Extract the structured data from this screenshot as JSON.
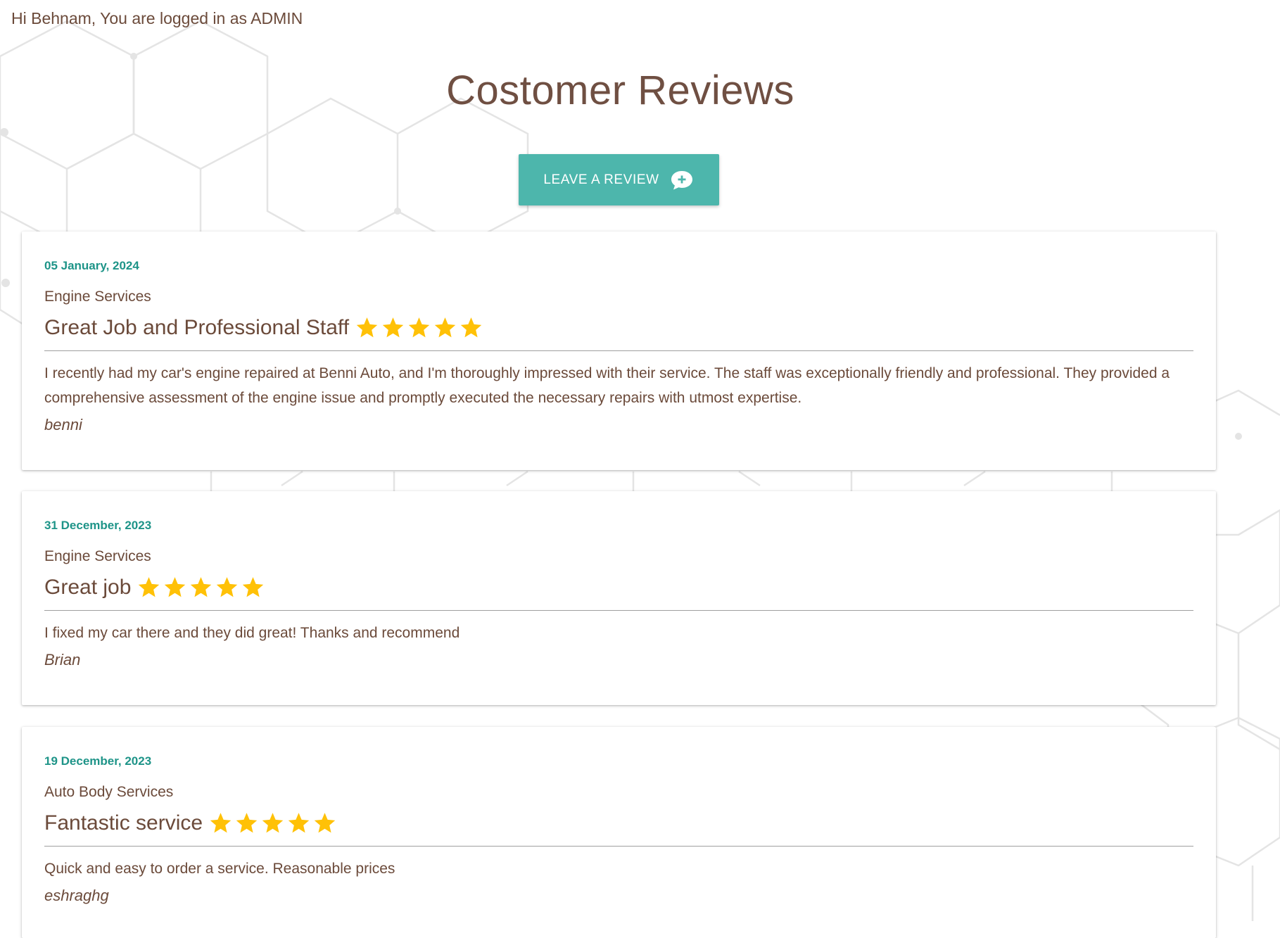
{
  "header": {
    "greeting": "Hi Behnam, You are logged in as ADMIN"
  },
  "page": {
    "title": "Costomer Reviews"
  },
  "actions": {
    "leave_review_label": "LEAVE A REVIEW",
    "leave_review_icon": "chat-add-icon"
  },
  "colors": {
    "accent": "#4db6ac",
    "date": "#1e9488",
    "text": "#6b4a3a",
    "star": "#ffc107"
  },
  "reviews": [
    {
      "date": "05 January, 2024",
      "service": "Engine Services",
      "title": "Great Job and Professional Staff",
      "rating": 5,
      "text": "I recently had my car's engine repaired at Benni Auto, and I'm thoroughly impressed with their service. The staff was exceptionally friendly and professional. They provided a comprehensive assessment of the engine issue and promptly executed the necessary repairs with utmost expertise.",
      "author": "benni"
    },
    {
      "date": "31 December, 2023",
      "service": "Engine Services",
      "title": "Great job",
      "rating": 5,
      "text": "I fixed my car there and they did great! Thanks and recommend",
      "author": "Brian"
    },
    {
      "date": "19 December, 2023",
      "service": "Auto Body Services",
      "title": "Fantastic service",
      "rating": 5,
      "text": "Quick and easy to order a service. Reasonable prices",
      "author": "eshraghg"
    }
  ]
}
